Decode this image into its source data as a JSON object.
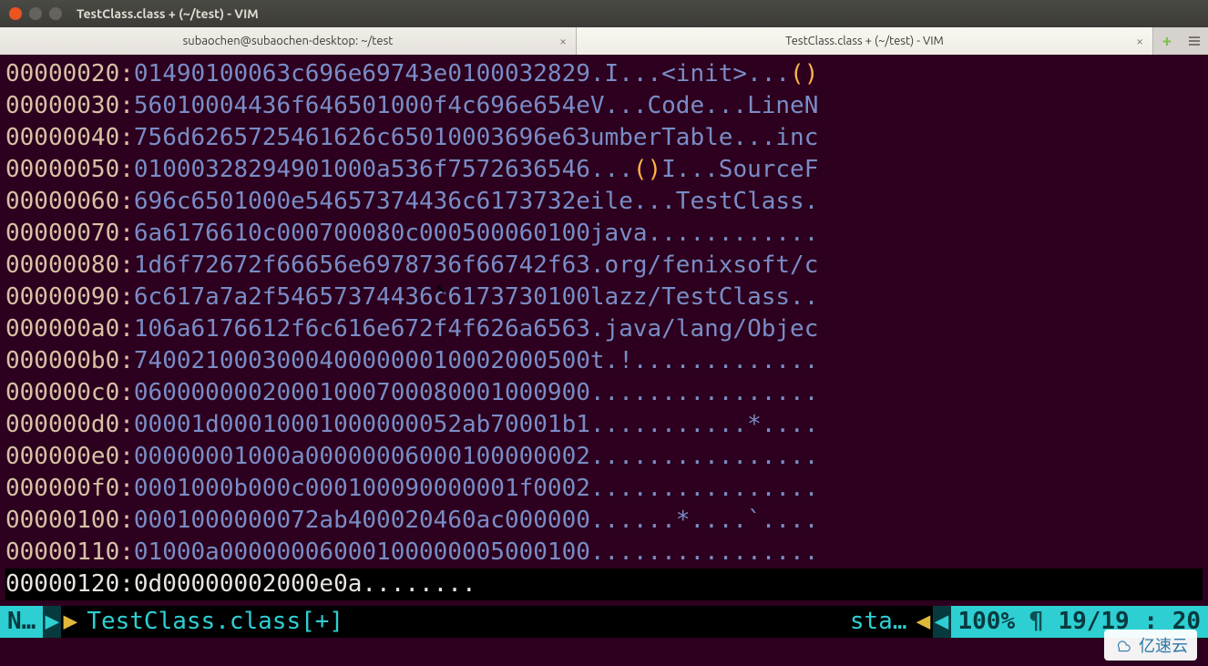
{
  "window": {
    "title": "TestClass.class + (~/test) - VIM"
  },
  "tabs": [
    {
      "label": "subaochen@subaochen-desktop: ~/test",
      "active": false
    },
    {
      "label": "TestClass.class + (~/test) - VIM",
      "active": true
    }
  ],
  "hexdump": {
    "rows": [
      {
        "addr": "00000020",
        "hex": [
          "0149",
          "0100",
          "063c",
          "696e",
          "6974",
          "3e01",
          "0003",
          "2829"
        ],
        "ascii": ".I...<init>...()"
      },
      {
        "addr": "00000030",
        "hex": [
          "5601",
          "0004",
          "436f",
          "6465",
          "0100",
          "0f4c",
          "696e",
          "654e"
        ],
        "ascii": "V...Code...LineN"
      },
      {
        "addr": "00000040",
        "hex": [
          "756d",
          "6265",
          "7254",
          "6162",
          "6c65",
          "0100",
          "0369",
          "6e63"
        ],
        "ascii": "umberTable...inc"
      },
      {
        "addr": "00000050",
        "hex": [
          "0100",
          "0328",
          "2949",
          "0100",
          "0a53",
          "6f75",
          "7263",
          "6546"
        ],
        "ascii": "...()I...SourceF"
      },
      {
        "addr": "00000060",
        "hex": [
          "696c",
          "6501",
          "000e",
          "5465",
          "7374",
          "436c",
          "6173",
          "732e"
        ],
        "ascii": "ile...TestClass."
      },
      {
        "addr": "00000070",
        "hex": [
          "6a61",
          "7661",
          "0c00",
          "0700",
          "080c",
          "0005",
          "0006",
          "0100"
        ],
        "ascii": "java............"
      },
      {
        "addr": "00000080",
        "hex": [
          "1d6f",
          "7267",
          "2f66",
          "656e",
          "6978",
          "736f",
          "6674",
          "2f63"
        ],
        "ascii": ".org/fenixsoft/c"
      },
      {
        "addr": "00000090",
        "hex": [
          "6c61",
          "7a7a",
          "2f54",
          "6573",
          "7443",
          "6c61",
          "7373",
          "0100"
        ],
        "ascii": "lazz/TestClass.."
      },
      {
        "addr": "000000a0",
        "hex": [
          "106a",
          "6176",
          "612f",
          "6c61",
          "6e67",
          "2f4f",
          "626a",
          "6563"
        ],
        "ascii": ".java/lang/Objec"
      },
      {
        "addr": "000000b0",
        "hex": [
          "7400",
          "2100",
          "0300",
          "0400",
          "0000",
          "0100",
          "0200",
          "0500"
        ],
        "ascii": "t.!............."
      },
      {
        "addr": "000000c0",
        "hex": [
          "0600",
          "0000",
          "0200",
          "0100",
          "0700",
          "0800",
          "0100",
          "0900"
        ],
        "ascii": "................"
      },
      {
        "addr": "000000d0",
        "hex": [
          "0000",
          "1d00",
          "0100",
          "0100",
          "0000",
          "052a",
          "b700",
          "01b1"
        ],
        "ascii": "...........*...."
      },
      {
        "addr": "000000e0",
        "hex": [
          "0000",
          "0001",
          "000a",
          "0000",
          "0006",
          "0001",
          "0000",
          "0002"
        ],
        "ascii": "................"
      },
      {
        "addr": "000000f0",
        "hex": [
          "0001",
          "000b",
          "000c",
          "0001",
          "0009",
          "0000",
          "001f",
          "0002"
        ],
        "ascii": "................"
      },
      {
        "addr": "00000100",
        "hex": [
          "0001",
          "0000",
          "0007",
          "2ab4",
          "0002",
          "0460",
          "ac00",
          "0000"
        ],
        "ascii": "......*....`...."
      },
      {
        "addr": "00000110",
        "hex": [
          "0100",
          "0a00",
          "0000",
          "0600",
          "0100",
          "0000",
          "0500",
          "0100"
        ],
        "ascii": "................"
      },
      {
        "addr": "00000120",
        "hex": [
          "0d00",
          "0000",
          "0200",
          "0e0a"
        ],
        "ascii": "........"
      }
    ]
  },
  "status": {
    "mode": "N…",
    "filename": "TestClass.class[+]",
    "right_hint": "sta…",
    "percent": "100%",
    "para": "¶",
    "line": "19",
    "total": "19",
    "col": "20"
  },
  "watermark": "亿速云"
}
